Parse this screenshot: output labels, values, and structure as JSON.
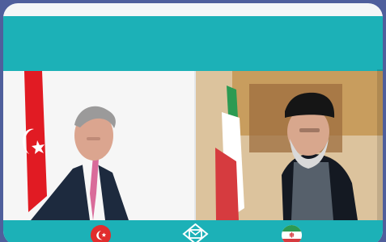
{
  "image": {
    "icons": {
      "left_flag_icon": "turkey-flag-icon",
      "center_icon": "mail-icon",
      "right_flag_icon": "iran-flag-icon"
    },
    "colors": {
      "background": "#4f5f9c",
      "card": "#f4f6f7",
      "teal": "#1cb1b7",
      "turkey_red": "#e12d2d",
      "iran_green": "#2c9a52",
      "iran_red": "#d63b3f"
    }
  }
}
